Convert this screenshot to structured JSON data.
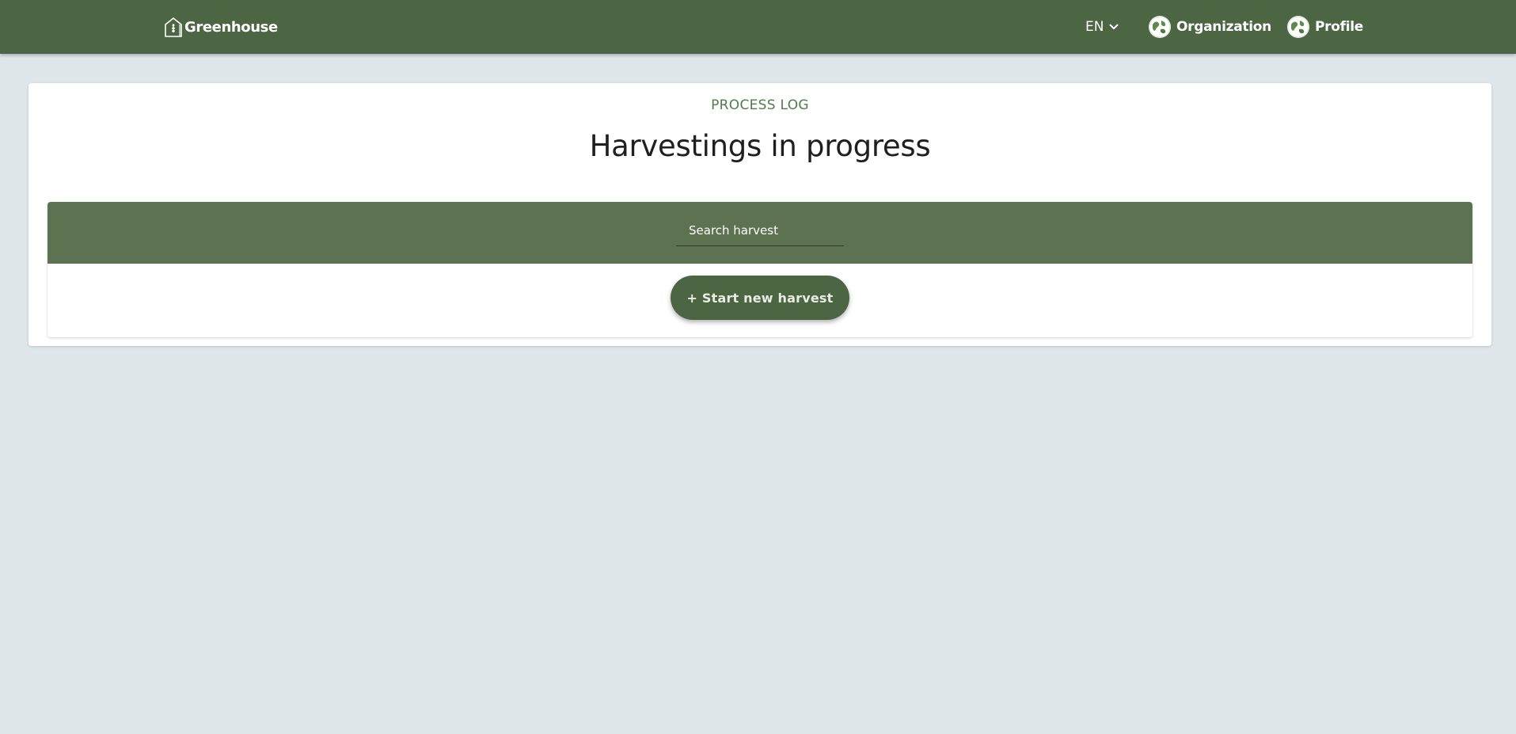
{
  "navbar": {
    "brand_text": "Greenhouse",
    "brand_icon": "greenhouse-plant-icon",
    "language": {
      "selected": "EN",
      "icon": "chevron-down-icon"
    },
    "links": [
      {
        "label": "Organization",
        "icon": "globe-avatar-icon"
      },
      {
        "label": "Profile",
        "icon": "globe-avatar-icon"
      }
    ]
  },
  "main": {
    "eyebrow": "PROCESS LOG",
    "title": "Harvestings in progress",
    "search": {
      "value": "",
      "placeholder": "Search harvest"
    },
    "start_button_label": "+ Start new harvest"
  },
  "colors": {
    "navbar_bg": "#4c6542",
    "panel_header_bg": "#5c7251",
    "page_bg": "#dfe6ea",
    "accent_text": "#4f7d4a",
    "button_bg": "#4c6542"
  }
}
